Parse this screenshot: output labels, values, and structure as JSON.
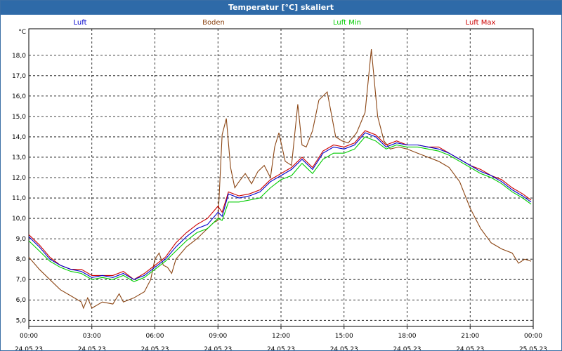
{
  "title": "Temperatur [°C] skaliert",
  "chart_data": {
    "type": "line",
    "title": "Temperatur [°C] skaliert",
    "ylabel": "°C",
    "ylim": [
      4.7,
      19.3
    ],
    "yticks": [
      "5,0",
      "6,0",
      "7,0",
      "8,0",
      "9,0",
      "10,0",
      "11,0",
      "12,0",
      "13,0",
      "14,0",
      "15,0",
      "16,0",
      "17,0",
      "18,0"
    ],
    "ytick_values": [
      5,
      6,
      7,
      8,
      9,
      10,
      11,
      12,
      13,
      14,
      15,
      16,
      17,
      18
    ],
    "xlim": [
      0,
      24
    ],
    "xtick_values": [
      0,
      3,
      6,
      9,
      12,
      15,
      18,
      21,
      24
    ],
    "xtick_times": [
      "00:00",
      "03:00",
      "06:00",
      "09:00",
      "12:00",
      "15:00",
      "18:00",
      "21:00",
      "00:00"
    ],
    "xtick_dates": [
      "24.05.23",
      "24.05.23",
      "24.05.23",
      "24.05.23",
      "24.05.23",
      "24.05.23",
      "24.05.23",
      "24.05.23",
      "25.05.23"
    ],
    "grid": true,
    "legend_position": "top",
    "series": [
      {
        "name": "Luft",
        "color": "#0000cc",
        "x": [
          0,
          0.5,
          1,
          1.5,
          2,
          2.5,
          3,
          3.5,
          4,
          4.5,
          5,
          5.5,
          6,
          6.5,
          7,
          7.5,
          8,
          8.5,
          9,
          9.2,
          9.5,
          10,
          10.5,
          11,
          11.5,
          12,
          12.5,
          13,
          13.5,
          14,
          14.5,
          15,
          15.5,
          16,
          16.5,
          17,
          17.5,
          18,
          18.5,
          19,
          19.5,
          20,
          20.5,
          21,
          21.5,
          22,
          22.5,
          23,
          23.5,
          23.9
        ],
        "y": [
          9.1,
          8.6,
          8.0,
          7.7,
          7.5,
          7.4,
          7.1,
          7.2,
          7.1,
          7.3,
          7.0,
          7.2,
          7.6,
          8.0,
          8.6,
          9.1,
          9.5,
          9.7,
          10.3,
          10.1,
          11.2,
          11.0,
          11.1,
          11.3,
          11.8,
          12.1,
          12.4,
          12.9,
          12.4,
          13.2,
          13.5,
          13.4,
          13.6,
          14.2,
          14.0,
          13.5,
          13.7,
          13.6,
          13.6,
          13.5,
          13.4,
          13.2,
          12.9,
          12.6,
          12.3,
          12.1,
          11.8,
          11.4,
          11.1,
          10.8
        ]
      },
      {
        "name": "Boden",
        "color": "#8b4513",
        "x": [
          0,
          0.5,
          1,
          1.5,
          2,
          2.5,
          2.6,
          2.8,
          3,
          3.5,
          4,
          4.3,
          4.5,
          5,
          5.5,
          5.8,
          6,
          6.2,
          6.4,
          6.6,
          6.8,
          7,
          7.5,
          8,
          8.5,
          8.8,
          9,
          9.2,
          9.4,
          9.6,
          9.8,
          10,
          10.3,
          10.6,
          10.9,
          11.2,
          11.5,
          11.7,
          11.9,
          12.2,
          12.5,
          12.8,
          13,
          13.2,
          13.5,
          13.8,
          14.2,
          14.6,
          14.9,
          15.2,
          15.6,
          16,
          16.3,
          16.6,
          16.9,
          17.2,
          17.6,
          18,
          18.5,
          19,
          19.5,
          20,
          20.5,
          21,
          21.5,
          22,
          22.5,
          23,
          23.3,
          23.6,
          23.9
        ],
        "y": [
          8.1,
          7.5,
          7.0,
          6.5,
          6.2,
          5.9,
          5.6,
          6.1,
          5.6,
          5.9,
          5.8,
          6.3,
          5.9,
          6.1,
          6.4,
          7.0,
          8.0,
          8.3,
          7.7,
          7.6,
          7.3,
          8.0,
          8.6,
          9.0,
          9.5,
          9.8,
          9.9,
          14.1,
          14.9,
          12.5,
          11.5,
          11.8,
          12.2,
          11.7,
          12.3,
          12.6,
          12.0,
          13.5,
          14.2,
          12.8,
          12.6,
          15.6,
          13.6,
          13.5,
          14.3,
          15.8,
          16.2,
          14.0,
          13.8,
          13.7,
          14.2,
          15.2,
          18.3,
          15.0,
          13.8,
          13.4,
          13.5,
          13.4,
          13.2,
          13.0,
          12.8,
          12.5,
          11.8,
          10.5,
          9.5,
          8.8,
          8.5,
          8.3,
          7.8,
          8.0,
          7.9
        ]
      },
      {
        "name": "Luft Min",
        "color": "#00cc00",
        "x": [
          0,
          0.5,
          1,
          1.5,
          2,
          2.5,
          3,
          3.5,
          4,
          4.5,
          5,
          5.5,
          6,
          6.5,
          7,
          7.5,
          8,
          8.5,
          9,
          9.2,
          9.5,
          10,
          10.5,
          11,
          11.5,
          12,
          12.5,
          13,
          13.5,
          14,
          14.5,
          15,
          15.5,
          16,
          16.5,
          17,
          17.5,
          18,
          18.5,
          19,
          19.5,
          20,
          20.5,
          21,
          21.5,
          22,
          22.5,
          23,
          23.5,
          23.9
        ],
        "y": [
          8.9,
          8.4,
          7.9,
          7.6,
          7.4,
          7.3,
          7.0,
          7.1,
          7.0,
          7.2,
          6.9,
          7.1,
          7.5,
          7.9,
          8.4,
          8.9,
          9.3,
          9.5,
          10.0,
          9.9,
          10.8,
          10.8,
          10.9,
          11.0,
          11.5,
          11.9,
          12.1,
          12.7,
          12.2,
          12.9,
          13.2,
          13.2,
          13.4,
          14.0,
          13.8,
          13.4,
          13.6,
          13.5,
          13.5,
          13.4,
          13.3,
          13.1,
          12.8,
          12.5,
          12.2,
          12.0,
          11.7,
          11.3,
          11.0,
          10.7
        ]
      },
      {
        "name": "Luft Max",
        "color": "#cc0000",
        "x": [
          0,
          0.5,
          1,
          1.5,
          2,
          2.5,
          3,
          3.5,
          4,
          4.5,
          5,
          5.5,
          6,
          6.5,
          7,
          7.5,
          8,
          8.5,
          9,
          9.2,
          9.5,
          10,
          10.5,
          11,
          11.5,
          12,
          12.5,
          13,
          13.5,
          14,
          14.5,
          15,
          15.5,
          16,
          16.5,
          17,
          17.5,
          18,
          18.5,
          19,
          19.5,
          20,
          20.5,
          21,
          21.5,
          22,
          22.5,
          23,
          23.5,
          23.9
        ],
        "y": [
          9.2,
          8.7,
          8.1,
          7.7,
          7.5,
          7.5,
          7.2,
          7.2,
          7.2,
          7.4,
          7.0,
          7.3,
          7.7,
          8.1,
          8.8,
          9.3,
          9.7,
          10.0,
          10.6,
          10.3,
          11.3,
          11.1,
          11.2,
          11.4,
          11.9,
          12.2,
          12.5,
          13.0,
          12.5,
          13.3,
          13.6,
          13.5,
          13.7,
          14.3,
          14.1,
          13.6,
          13.8,
          13.6,
          13.6,
          13.5,
          13.5,
          13.2,
          12.9,
          12.6,
          12.4,
          12.1,
          11.9,
          11.5,
          11.2,
          10.9
        ]
      }
    ]
  }
}
